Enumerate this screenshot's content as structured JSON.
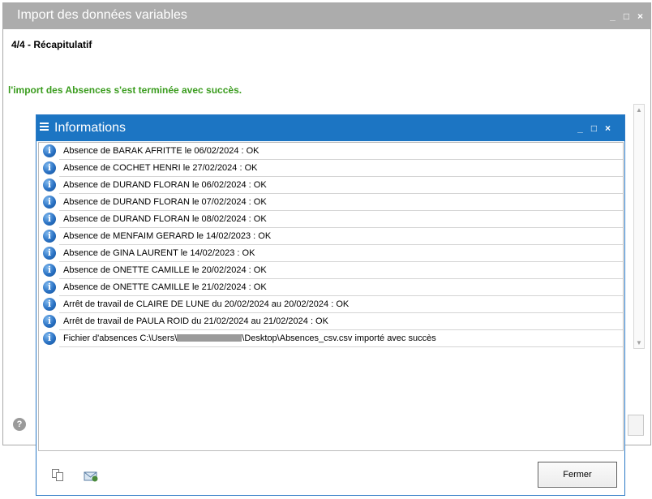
{
  "background_window": {
    "title": "Import des données variables",
    "step": "4/4 - Récapitulatif",
    "success_message": "l'import des Absences s'est terminée avec succès.",
    "controls": {
      "minimize": "_",
      "maximize": "□",
      "close": "×"
    },
    "scroll_up": "▲",
    "scroll_down": "▼",
    "help": "?"
  },
  "dialog": {
    "title": "Informations",
    "controls": {
      "minimize": "_",
      "maximize": "□",
      "close": "×"
    },
    "items": [
      {
        "icon": "info-icon",
        "text": "Absence de BARAK AFRITTE le 06/02/2024 : OK"
      },
      {
        "icon": "info-icon",
        "text": "Absence de COCHET HENRI le 27/02/2024 : OK"
      },
      {
        "icon": "info-icon",
        "text": "Absence de DURAND FLORAN le 06/02/2024 : OK"
      },
      {
        "icon": "info-icon",
        "text": "Absence de DURAND FLORAN le 07/02/2024 : OK"
      },
      {
        "icon": "info-icon",
        "text": "Absence de DURAND FLORAN le 08/02/2024 : OK"
      },
      {
        "icon": "info-icon",
        "text": "Absence de MENFAIM GERARD le 14/02/2023 : OK"
      },
      {
        "icon": "info-icon",
        "text": "Absence de GINA LAURENT le 14/02/2023 : OK"
      },
      {
        "icon": "info-icon",
        "text": "Absence de ONETTE CAMILLE le 20/02/2024 : OK"
      },
      {
        "icon": "info-icon",
        "text": "Absence de ONETTE CAMILLE le 21/02/2024 : OK"
      },
      {
        "icon": "info-icon",
        "text": "Arrêt de travail de CLAIRE DE LUNE du 20/02/2024 au 20/02/2024 : OK"
      },
      {
        "icon": "info-icon",
        "text": "Arrêt de travail de PAULA ROID du 21/02/2024 au 21/02/2024 : OK"
      }
    ],
    "file_item": {
      "icon": "info-icon",
      "prefix": "Fichier d'absences C:\\Users\\",
      "suffix": "\\Desktop\\Absences_csv.csv importé avec succès"
    },
    "close_button": "Fermer"
  }
}
